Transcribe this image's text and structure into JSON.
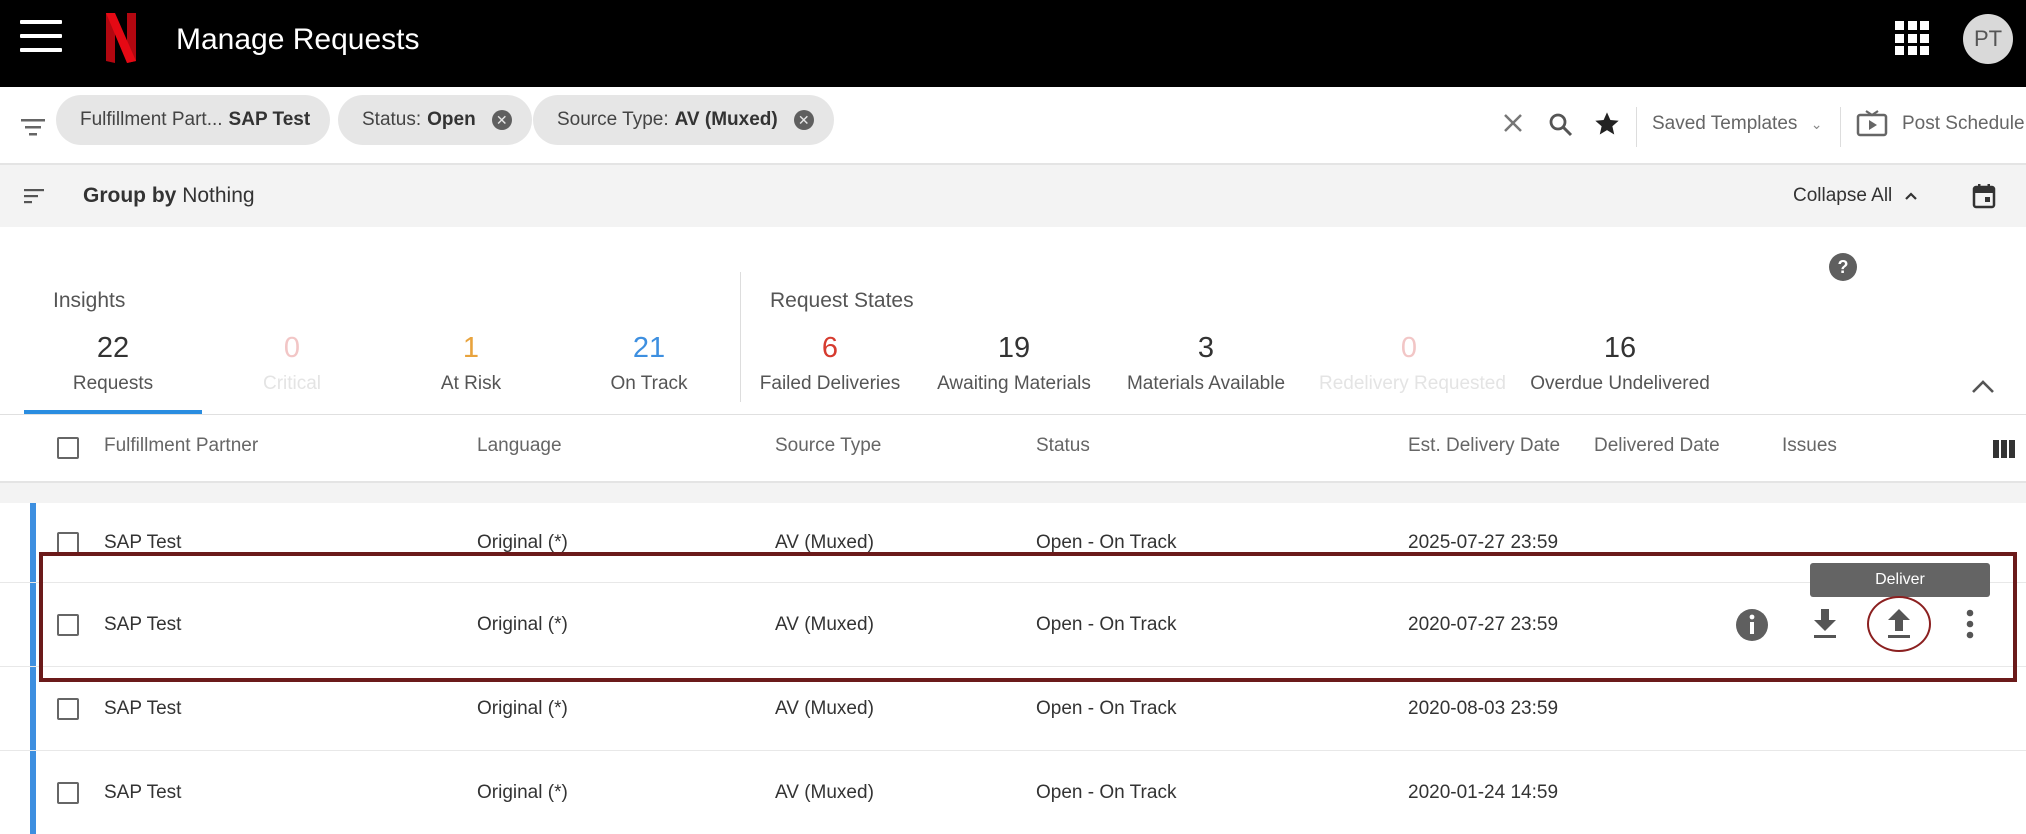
{
  "app": {
    "title": "Manage Requests",
    "user_initials": "PT",
    "brand_color": "#e50914"
  },
  "filters": {
    "chips": [
      {
        "key": "Fulfillment Part...",
        "value": "SAP Test"
      },
      {
        "key": "Status:",
        "value": "Open"
      },
      {
        "key": "Source Type:",
        "value": "AV (Muxed)"
      }
    ],
    "saved_templates_label": "Saved Templates",
    "post_schedule_label": "Post Schedule"
  },
  "group": {
    "label": "Group by",
    "value": "Nothing",
    "collapse_label": "Collapse All"
  },
  "insights": {
    "title": "Insights",
    "metrics": [
      {
        "value": "22",
        "label": "Requests",
        "color": "#333333"
      },
      {
        "value": "0",
        "label": "Critical",
        "color": "#f2c6c6"
      },
      {
        "value": "1",
        "label": "At Risk",
        "color": "#e8a33d"
      },
      {
        "value": "21",
        "label": "On Track",
        "color": "#3d8fe0"
      }
    ]
  },
  "request_states": {
    "title": "Request States",
    "metrics": [
      {
        "value": "6",
        "label": "Failed Deliveries",
        "color": "#d63b2f"
      },
      {
        "value": "19",
        "label": "Awaiting Materials",
        "color": "#333333"
      },
      {
        "value": "3",
        "label": "Materials Available",
        "color": "#333333"
      },
      {
        "value": "0",
        "label": "Redelivery Requested",
        "color": "#f2c6c6"
      },
      {
        "value": "16",
        "label": "Overdue Undelivered",
        "color": "#333333"
      }
    ]
  },
  "table": {
    "columns": [
      "Fulfillment Partner",
      "Language",
      "Source Type",
      "Status",
      "Est. Delivery Date",
      "Delivered Date",
      "Issues"
    ],
    "rows": [
      {
        "partner": "SAP Test",
        "language": "Original (*)",
        "source": "AV (Muxed)",
        "status": "Open - On Track",
        "est": "2025-07-27 23:59",
        "delivered": ""
      },
      {
        "partner": "SAP Test",
        "language": "Original (*)",
        "source": "AV (Muxed)",
        "status": "Open - On Track",
        "est": "2020-07-27 23:59",
        "delivered": ""
      },
      {
        "partner": "SAP Test",
        "language": "Original (*)",
        "source": "AV (Muxed)",
        "status": "Open - On Track",
        "est": "2020-08-03 23:59",
        "delivered": ""
      },
      {
        "partner": "SAP Test",
        "language": "Original (*)",
        "source": "AV (Muxed)",
        "status": "Open - On Track",
        "est": "2020-01-24 14:59",
        "delivered": ""
      }
    ],
    "accent_color": "#3d8fe0"
  },
  "tooltip": {
    "deliver": "Deliver"
  }
}
